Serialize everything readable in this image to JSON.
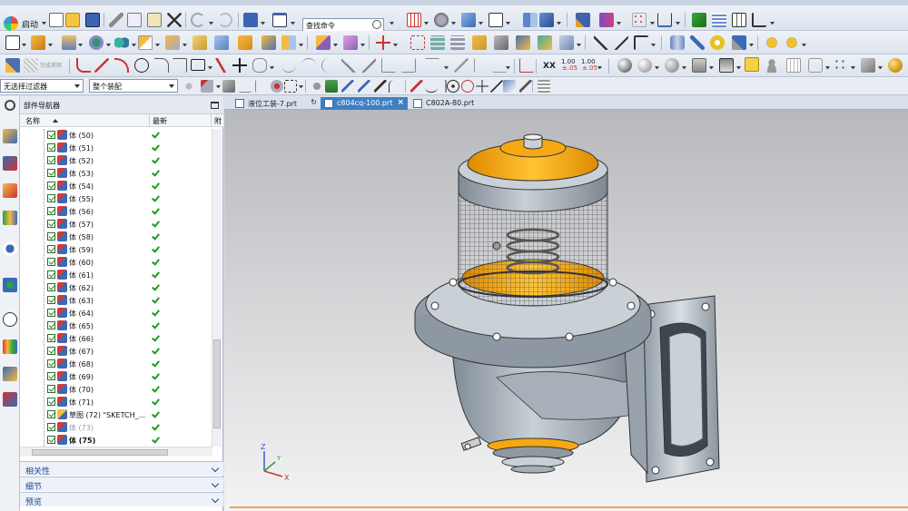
{
  "toolbar": {
    "start_label": "启动",
    "command_search_placeholder": "查找命令",
    "dim_xx": "XX",
    "dim_100_a": "1.00",
    "dim_tol_a": "±.05",
    "dim_100_b": "1.00",
    "dim_tol_b": "±.05"
  },
  "selection_bar": {
    "filter": "无选择过滤器",
    "scope": "整个装配"
  },
  "navigator": {
    "title": "部件导航器",
    "columns": {
      "name": "名称",
      "latest": "最新",
      "extra": "附"
    },
    "rows": [
      {
        "label": "体 (50)",
        "style": "normal"
      },
      {
        "label": "体 (51)",
        "style": "normal"
      },
      {
        "label": "体 (52)",
        "style": "normal"
      },
      {
        "label": "体 (53)",
        "style": "normal"
      },
      {
        "label": "体 (54)",
        "style": "normal"
      },
      {
        "label": "体 (55)",
        "style": "normal"
      },
      {
        "label": "体 (56)",
        "style": "normal"
      },
      {
        "label": "体 (57)",
        "style": "normal"
      },
      {
        "label": "体 (58)",
        "style": "normal"
      },
      {
        "label": "体 (59)",
        "style": "normal"
      },
      {
        "label": "体 (60)",
        "style": "normal"
      },
      {
        "label": "体 (61)",
        "style": "normal"
      },
      {
        "label": "体 (62)",
        "style": "normal"
      },
      {
        "label": "体 (63)",
        "style": "normal"
      },
      {
        "label": "体 (64)",
        "style": "normal"
      },
      {
        "label": "体 (65)",
        "style": "normal"
      },
      {
        "label": "体 (66)",
        "style": "normal"
      },
      {
        "label": "体 (67)",
        "style": "normal"
      },
      {
        "label": "体 (68)",
        "style": "normal"
      },
      {
        "label": "体 (69)",
        "style": "normal"
      },
      {
        "label": "体 (70)",
        "style": "normal"
      },
      {
        "label": "体 (71)",
        "style": "normal"
      },
      {
        "label": "草图 (72) \"SKETCH_...",
        "style": "sketch"
      },
      {
        "label": "体 (73)",
        "style": "gray"
      },
      {
        "label": "体 (75)",
        "style": "bold"
      }
    ],
    "panels": [
      "相关性",
      "细节",
      "预览"
    ]
  },
  "tabs": [
    {
      "label": "液位工装-7.prt",
      "active": false
    },
    {
      "label": "c804cq-100.prt",
      "active": true
    },
    {
      "label": "C802A-80.prt",
      "active": false
    }
  ],
  "triad": {
    "x": "X",
    "y": "Y",
    "z": "Z"
  },
  "colors": {
    "accent": "#3f7fc4",
    "model_gray": "#a9b3bc",
    "model_orange": "#f5a811",
    "check_green": "#1b9c1b"
  }
}
